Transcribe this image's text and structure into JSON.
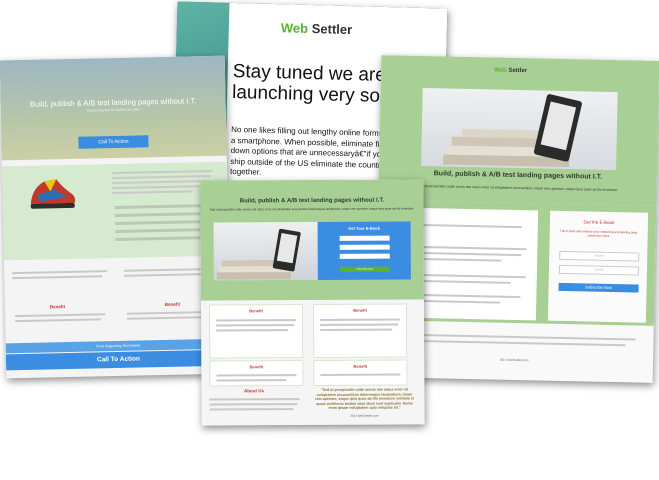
{
  "back": {
    "logo_a": "Web",
    "logo_b": "Settler",
    "headline": "Stay tuned we are launching very soon...",
    "body": "No one likes filling out lengthy online forms, especially on a smartphone. When possible, eliminate fields or trim down options that are unnecessaryâ€\"if you donâ€™t ship outside of the US eliminate the country field all together."
  },
  "left": {
    "hero_title": "Build, publish & A/B test landing pages without I.T.",
    "hero_sub": "Supporting line to explain the offer",
    "cta": "Call To Action",
    "benefit_a": "Benefit",
    "benefit_b": "Benefit",
    "pre_footer": "Final Supporting Text Needs",
    "footer_cta": "Call To Action"
  },
  "right": {
    "logo_a": "Web",
    "logo_b": "Settler",
    "title": "Build, publish & A/B test landing pages without I.T.",
    "lead": "Sed ut perspiciatis unde omnis iste natus error sit voluptatem accusantium, totam rem aperiam, eaque ipsa quae ab illo inventore.",
    "section_heading": "Heading",
    "form_title": "Get the E-Book",
    "form_sub": "The E-book will enhance your marketing and landing page conversion rates.",
    "name_ph": "Name",
    "email_ph": "Email",
    "subscribe": "Subscribe Now",
    "copyright": "2014 WebSettler.com"
  },
  "front": {
    "title": "Build, publish & A/B test landing pages without I.T.",
    "lead": "Sed ut perspiciatis unde omnis iste natus error sit voluptatem accusantium doloremque laudantium, totam rem aperiam, eaque ipsa quae ab illo inventore.",
    "optin_title": "Get Your E-Book",
    "optin_btn": "Subscribe Now",
    "benefits": [
      "Benefit",
      "Benefit",
      "Benefit",
      "Benefit"
    ],
    "about": "About Us",
    "quote": "\"Sed ut perspiciatis unde omnis iste natus error sit voluptatem accusantium doloremque laudantium, totam rem aperiam, eaque ipsa quae ab illo inventore veritatis et quasi architecto beatae vitae dicta sunt explicabo. Nemo enim ipsam voluptatem quia voluptas sit.\"",
    "copyright": "2014 WebSettler.com"
  }
}
